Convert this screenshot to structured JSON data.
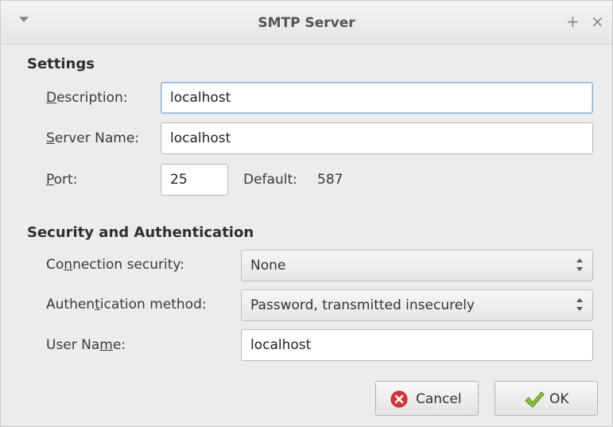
{
  "window": {
    "title": "SMTP Server",
    "pin_glyph": "+",
    "close_glyph": "×"
  },
  "settings": {
    "heading": "Settings",
    "description": {
      "label_pre": "",
      "label_ul": "D",
      "label_post": "escription:",
      "value": "localhost"
    },
    "server_name": {
      "label_pre": "",
      "label_ul": "S",
      "label_post": "erver Name:",
      "value": "localhost"
    },
    "port": {
      "label_pre": "",
      "label_ul": "P",
      "label_post": "ort:",
      "value": "25",
      "default_label": "Default:",
      "default_value": "587"
    }
  },
  "security": {
    "heading": "Security and Authentication",
    "connection": {
      "label_pre": "Co",
      "label_ul": "n",
      "label_post": "nection security:",
      "selected": "None"
    },
    "auth": {
      "label_pre": "Authen",
      "label_ul": "t",
      "label_post": "ication method:",
      "selected": "Password, transmitted insecurely"
    },
    "username": {
      "label_pre": "User Na",
      "label_ul": "m",
      "label_post": "e:",
      "value": "localhost"
    }
  },
  "buttons": {
    "cancel": "Cancel",
    "ok": "OK"
  },
  "colors": {
    "cancel_icon": "#d9343a",
    "ok_icon": "#8cbf3c",
    "focus_border": "#8db2d8"
  }
}
